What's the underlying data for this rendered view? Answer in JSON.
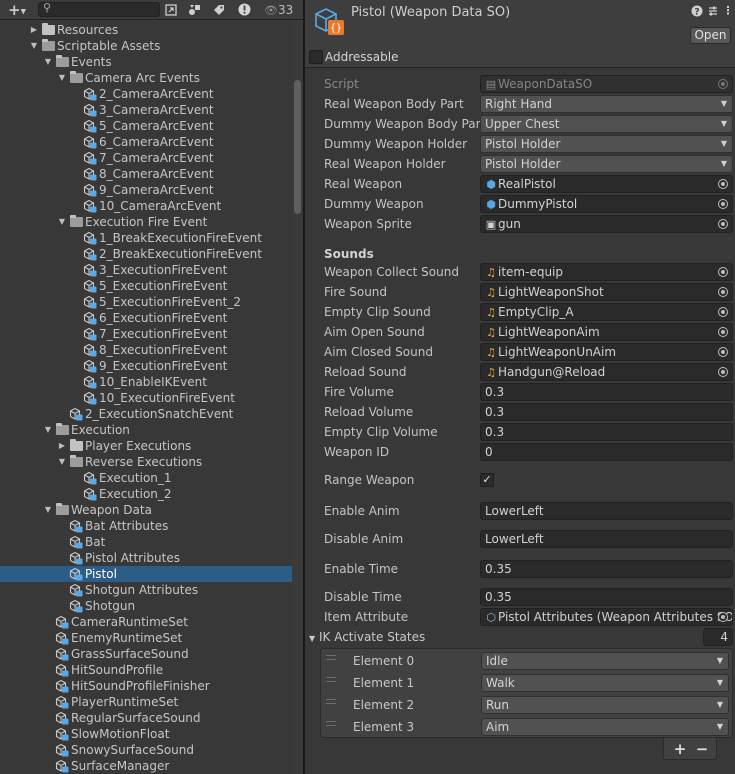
{
  "project": {
    "add_symbol": "+",
    "search": {
      "placeholder": "",
      "value": ""
    },
    "hidden_count": "33",
    "tree": [
      {
        "label": "Resources",
        "depth": 0,
        "kind": "folder",
        "state": "collapsed"
      },
      {
        "label": "Scriptable Assets",
        "depth": 0,
        "kind": "folder",
        "state": "expanded"
      },
      {
        "label": "Events",
        "depth": 1,
        "kind": "folder",
        "state": "expanded"
      },
      {
        "label": "Camera Arc Events",
        "depth": 2,
        "kind": "folder",
        "state": "expanded"
      },
      {
        "label": "2_CameraArcEvent",
        "depth": 3,
        "kind": "asset"
      },
      {
        "label": "3_CameraArcEvent",
        "depth": 3,
        "kind": "asset"
      },
      {
        "label": "5_CameraArcEvent",
        "depth": 3,
        "kind": "asset"
      },
      {
        "label": "6_CameraArcEvent",
        "depth": 3,
        "kind": "asset"
      },
      {
        "label": "7_CameraArcEvent",
        "depth": 3,
        "kind": "asset"
      },
      {
        "label": "8_CameraArcEvent",
        "depth": 3,
        "kind": "asset"
      },
      {
        "label": "9_CameraArcEvent",
        "depth": 3,
        "kind": "asset"
      },
      {
        "label": "10_CameraArcEvent",
        "depth": 3,
        "kind": "asset"
      },
      {
        "label": "Execution Fire Event",
        "depth": 2,
        "kind": "folder",
        "state": "expanded"
      },
      {
        "label": "1_BreakExecutionFireEvent",
        "depth": 3,
        "kind": "asset"
      },
      {
        "label": "2_BreakExecutionFireEvent",
        "depth": 3,
        "kind": "asset"
      },
      {
        "label": "3_ExecutionFireEvent",
        "depth": 3,
        "kind": "asset"
      },
      {
        "label": "5_ExecutionFireEvent",
        "depth": 3,
        "kind": "asset"
      },
      {
        "label": "5_ExecutionFireEvent_2",
        "depth": 3,
        "kind": "asset"
      },
      {
        "label": "6_ExecutionFireEvent",
        "depth": 3,
        "kind": "asset"
      },
      {
        "label": "7_ExecutionFireEvent",
        "depth": 3,
        "kind": "asset"
      },
      {
        "label": "8_ExecutionFireEvent",
        "depth": 3,
        "kind": "asset"
      },
      {
        "label": "9_ExecutionFireEvent",
        "depth": 3,
        "kind": "asset"
      },
      {
        "label": "10_EnableIKEvent",
        "depth": 3,
        "kind": "asset"
      },
      {
        "label": "10_ExecutionFireEvent",
        "depth": 3,
        "kind": "asset"
      },
      {
        "label": "2_ExecutionSnatchEvent",
        "depth": 2,
        "kind": "asset"
      },
      {
        "label": "Execution",
        "depth": 1,
        "kind": "folder",
        "state": "expanded"
      },
      {
        "label": "Player Executions",
        "depth": 2,
        "kind": "folder",
        "state": "collapsed"
      },
      {
        "label": "Reverse Executions",
        "depth": 2,
        "kind": "folder",
        "state": "expanded"
      },
      {
        "label": "Execution_1",
        "depth": 3,
        "kind": "asset"
      },
      {
        "label": "Execution_2",
        "depth": 3,
        "kind": "asset"
      },
      {
        "label": "Weapon Data",
        "depth": 1,
        "kind": "folder",
        "state": "expanded"
      },
      {
        "label": "Bat Attributes",
        "depth": 2,
        "kind": "asset"
      },
      {
        "label": "Bat",
        "depth": 2,
        "kind": "asset"
      },
      {
        "label": "Pistol Attributes",
        "depth": 2,
        "kind": "asset"
      },
      {
        "label": "Pistol",
        "depth": 2,
        "kind": "asset",
        "selected": true
      },
      {
        "label": "Shotgun Attributes",
        "depth": 2,
        "kind": "asset"
      },
      {
        "label": "Shotgun",
        "depth": 2,
        "kind": "asset"
      },
      {
        "label": "CameraRuntimeSet",
        "depth": 1,
        "kind": "asset"
      },
      {
        "label": "EnemyRuntimeSet",
        "depth": 1,
        "kind": "asset"
      },
      {
        "label": "GrassSurfaceSound",
        "depth": 1,
        "kind": "asset"
      },
      {
        "label": "HitSoundProfile",
        "depth": 1,
        "kind": "asset"
      },
      {
        "label": "HitSoundProfileFinisher",
        "depth": 1,
        "kind": "asset"
      },
      {
        "label": "PlayerRuntimeSet",
        "depth": 1,
        "kind": "asset"
      },
      {
        "label": "RegularSurfaceSound",
        "depth": 1,
        "kind": "asset"
      },
      {
        "label": "SlowMotionFloat",
        "depth": 1,
        "kind": "asset"
      },
      {
        "label": "SnowySurfaceSound",
        "depth": 1,
        "kind": "asset"
      },
      {
        "label": "SurfaceManager",
        "depth": 1,
        "kind": "asset"
      }
    ]
  },
  "inspector": {
    "title": "Pistol (Weapon Data SO)",
    "open_label": "Open",
    "addressable_label": "Addressable",
    "script": {
      "label": "Script",
      "value": "WeaponDataSO"
    },
    "props": [
      {
        "label": "Real Weapon Body Part",
        "value": "Right Hand",
        "type": "dropdown"
      },
      {
        "label": "Dummy Weapon Body Part",
        "value": "Upper Chest",
        "type": "dropdown"
      },
      {
        "label": "Dummy Weapon Holder",
        "value": "Pistol Holder",
        "type": "dropdown"
      },
      {
        "label": "Real Weapon Holder",
        "value": "Pistol Holder",
        "type": "dropdown"
      },
      {
        "label": "Real Weapon",
        "value": "RealPistol",
        "type": "object",
        "icon": "prefab-icon"
      },
      {
        "label": "Dummy Weapon",
        "value": "DummyPistol",
        "type": "object",
        "icon": "prefab-icon"
      },
      {
        "label": "Weapon Sprite",
        "value": "gun",
        "type": "object",
        "icon": "sprite-icon"
      }
    ],
    "sounds_header": "Sounds",
    "sounds": [
      {
        "label": "Weapon Collect Sound",
        "value": "item-equip"
      },
      {
        "label": "Fire Sound",
        "value": "LightWeaponShot"
      },
      {
        "label": "Empty Clip Sound",
        "value": "EmptyClip_A"
      },
      {
        "label": "Aim Open Sound",
        "value": "LightWeaponAim"
      },
      {
        "label": "Aim Closed Sound",
        "value": "LightWeaponUnAim"
      },
      {
        "label": "Reload Sound",
        "value": "Handgun@Reload"
      }
    ],
    "numbers": [
      {
        "label": "Fire Volume",
        "value": "0.3"
      },
      {
        "label": "Reload Volume",
        "value": "0.3"
      },
      {
        "label": "Empty Clip Volume",
        "value": "0.3"
      },
      {
        "label": "Weapon ID",
        "value": "0"
      }
    ],
    "range_weapon": {
      "label": "Range Weapon",
      "checked": true,
      "mark": "✓"
    },
    "enable_anim": {
      "label": "Enable Anim",
      "value": "LowerLeft"
    },
    "disable_anim": {
      "label": "Disable Anim",
      "value": "LowerLeft"
    },
    "enable_time": {
      "label": "Enable Time",
      "value": "0.35"
    },
    "disable_time": {
      "label": "Disable Time",
      "value": "0.35"
    },
    "item_attribute": {
      "label": "Item Attribute",
      "value": "Pistol Attributes (Weapon Attributes SO)"
    },
    "ik": {
      "label": "IK Activate States",
      "count": "4",
      "elements": [
        {
          "label": "Element 0",
          "value": "Idle"
        },
        {
          "label": "Element 1",
          "value": "Walk"
        },
        {
          "label": "Element 2",
          "value": "Run"
        },
        {
          "label": "Element 3",
          "value": "Aim"
        }
      ],
      "add_label": "+",
      "remove_label": "−"
    }
  }
}
